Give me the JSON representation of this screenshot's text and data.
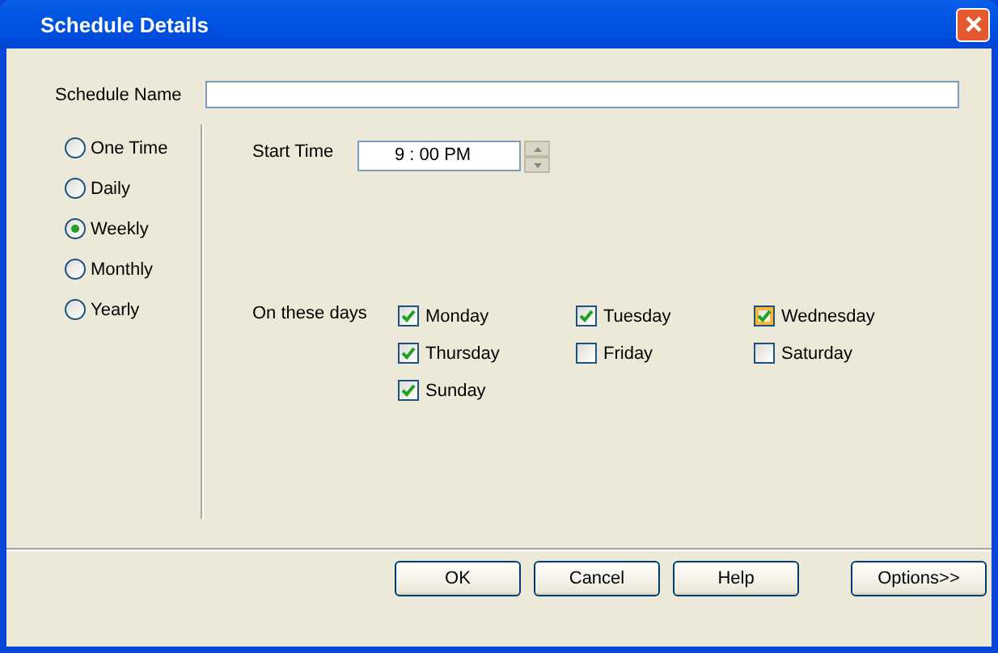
{
  "window": {
    "title": "Schedule Details"
  },
  "schedule_name": {
    "label": "Schedule Name"
  },
  "frequency": [
    {
      "label": "One Time",
      "selected": false
    },
    {
      "label": "Daily",
      "selected": false
    },
    {
      "label": "Weekly",
      "selected": true
    },
    {
      "label": "Monthly",
      "selected": false
    },
    {
      "label": "Yearly",
      "selected": false
    }
  ],
  "start_time": {
    "label": "Start Time",
    "value": "9 : 00 PM"
  },
  "days": {
    "label": "On these days",
    "items": [
      {
        "label": "Monday",
        "checked": true,
        "hovered": false
      },
      {
        "label": "Tuesday",
        "checked": true,
        "hovered": false
      },
      {
        "label": "Wednesday",
        "checked": true,
        "hovered": true
      },
      {
        "label": "Thursday",
        "checked": true,
        "hovered": false
      },
      {
        "label": "Friday",
        "checked": false,
        "hovered": false
      },
      {
        "label": "Saturday",
        "checked": false,
        "hovered": false
      },
      {
        "label": "Sunday",
        "checked": true,
        "hovered": false
      }
    ]
  },
  "buttons": [
    "OK",
    "Cancel",
    "Help"
  ],
  "options_button": "Options>>"
}
